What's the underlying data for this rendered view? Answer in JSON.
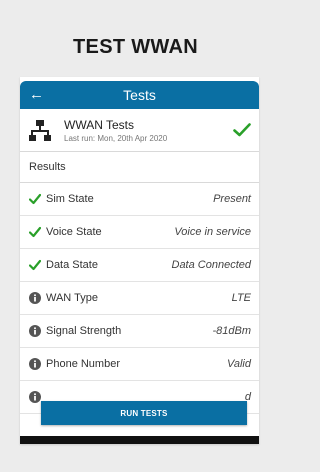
{
  "page_title": "TEST WWAN",
  "appbar": {
    "back_glyph": "←",
    "title": "Tests",
    "background": "#0a6fa3"
  },
  "test_card": {
    "icon": "network-icon",
    "title": "WWAN Tests",
    "subtitle": "Last run: Mon, 20th Apr 2020",
    "status_icon": "check-icon"
  },
  "section_header": "Results",
  "results": [
    {
      "label": "Sim State",
      "value": "Present",
      "icon": "check-icon"
    },
    {
      "label": "Voice State",
      "value": "Voice in service",
      "icon": "check-icon"
    },
    {
      "label": "Data State",
      "value": "Data Connected",
      "icon": "check-icon"
    },
    {
      "label": "WAN Type",
      "value": "LTE",
      "icon": "info-icon"
    },
    {
      "label": "Signal Strength",
      "value": "-81dBm",
      "icon": "info-icon"
    },
    {
      "label": "Phone Number",
      "value": "Valid",
      "icon": "info-icon"
    },
    {
      "label": "",
      "value": "d",
      "icon": "info-icon"
    }
  ],
  "run_button": "RUN TESTS",
  "colors": {
    "accent": "#0a6fa3",
    "success": "#2aa02a",
    "info": "#555555"
  }
}
